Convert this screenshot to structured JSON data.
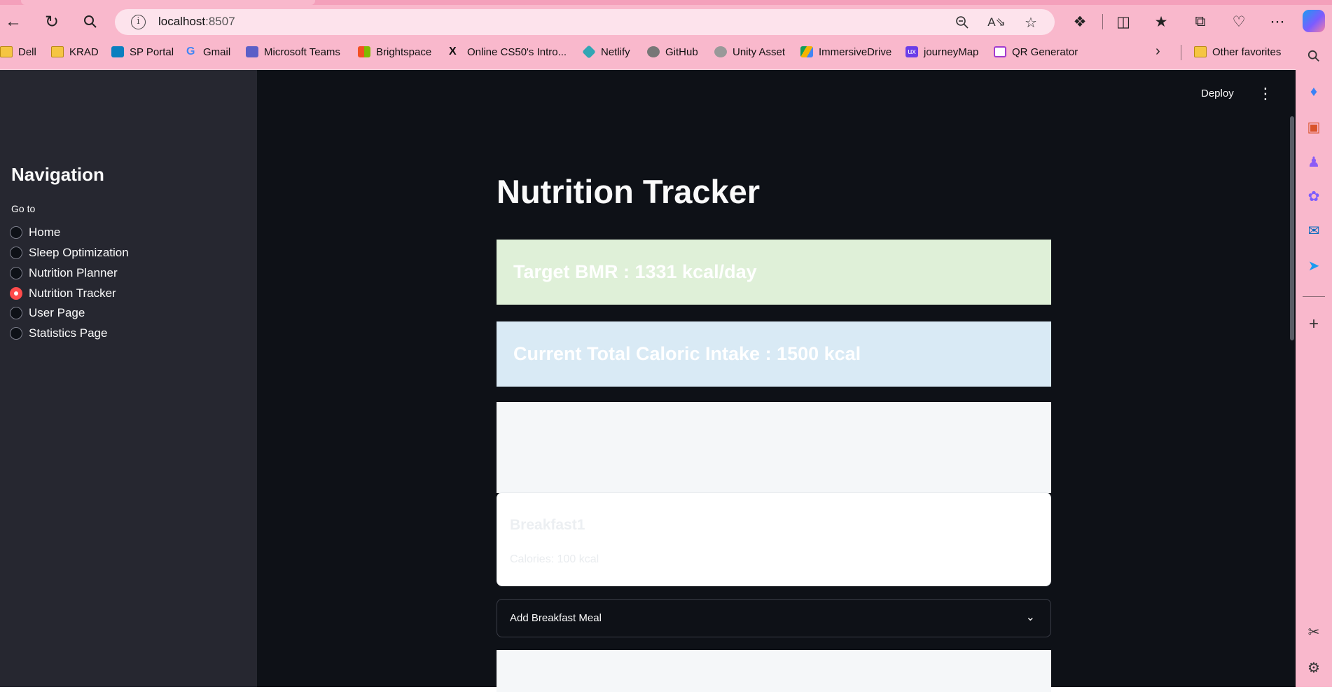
{
  "browser": {
    "url_host": "localhost",
    "url_port": ":8507",
    "bookmarks": [
      {
        "label": "Dell",
        "icon": "folder-icon"
      },
      {
        "label": "KRAD",
        "icon": "folder-icon"
      },
      {
        "label": "SP Portal",
        "icon": "sharepoint-icon"
      },
      {
        "label": "Gmail",
        "icon": "google-icon"
      },
      {
        "label": "Microsoft Teams",
        "icon": "teams-icon"
      },
      {
        "label": "Brightspace",
        "icon": "brightspace-icon"
      },
      {
        "label": "Online CS50's Intro...",
        "icon": "edx-icon"
      },
      {
        "label": "Netlify",
        "icon": "netlify-icon"
      },
      {
        "label": "GitHub",
        "icon": "github-icon"
      },
      {
        "label": "Unity Asset",
        "icon": "unity-icon"
      },
      {
        "label": "ImmersiveDrive",
        "icon": "google-drive-icon"
      },
      {
        "label": "journeyMap",
        "icon": "ux-icon"
      },
      {
        "label": "QR Generator",
        "icon": "qr-icon"
      }
    ],
    "other_favorites": "Other favorites"
  },
  "app": {
    "deploy_label": "Deploy",
    "sidebar": {
      "title": "Navigation",
      "goto_label": "Go to",
      "options": [
        "Home",
        "Sleep Optimization",
        "Nutrition Planner",
        "Nutrition Tracker",
        "User Page",
        "Statistics Page"
      ],
      "selected": "Nutrition Tracker"
    },
    "main": {
      "title": "Nutrition Tracker",
      "bmr_text": "Target BMR : 1331 kcal/day",
      "intake_text": "Current Total Caloric Intake : 1500 kcal",
      "meal_card": {
        "name": "Breakfast1",
        "calories": "Calories: 100 kcal"
      },
      "expander_label": "Add Breakfast Meal"
    },
    "colors": {
      "accent": "#ff4b4b",
      "background": "#0e1117",
      "sidebar": "#262730",
      "bmr_box": "#dff0d8",
      "intake_box": "#d9eaf5"
    }
  }
}
